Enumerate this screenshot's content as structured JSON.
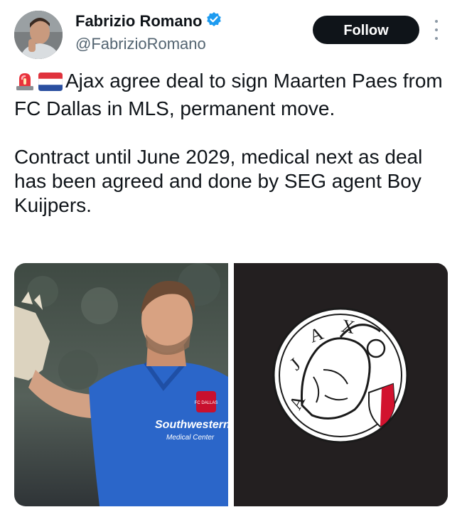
{
  "author": {
    "name": "Fabrizio Romano",
    "handle": "@FabrizioRomano",
    "verified": true
  },
  "actions": {
    "follow_label": "Follow"
  },
  "tweet": {
    "emojis": [
      "rotating-light",
      "netherlands-flag"
    ],
    "paragraph1": "Ajax agree deal to sign Maarten Paes from FC Dallas in MLS, permanent move.",
    "paragraph2": "Contract until June 2029, medical next as deal has been agreed and done by SEG agent Boy Kuijpers."
  },
  "media": {
    "photo_left": {
      "subject": "goalkeeper-photo",
      "badge_text": "FC DALLAS",
      "sponsor_line1": "Southwestern",
      "sponsor_line2": "Medical Center"
    },
    "photo_right": {
      "subject": "ajax-crest",
      "crest_text": "AJAX"
    }
  },
  "colors": {
    "text": "#0f1419",
    "secondary": "#536471",
    "verified_blue": "#1d9bf0",
    "follow_bg": "#0f1419",
    "jersey_blue": "#2b66c9",
    "crest_bg": "#231f20"
  }
}
